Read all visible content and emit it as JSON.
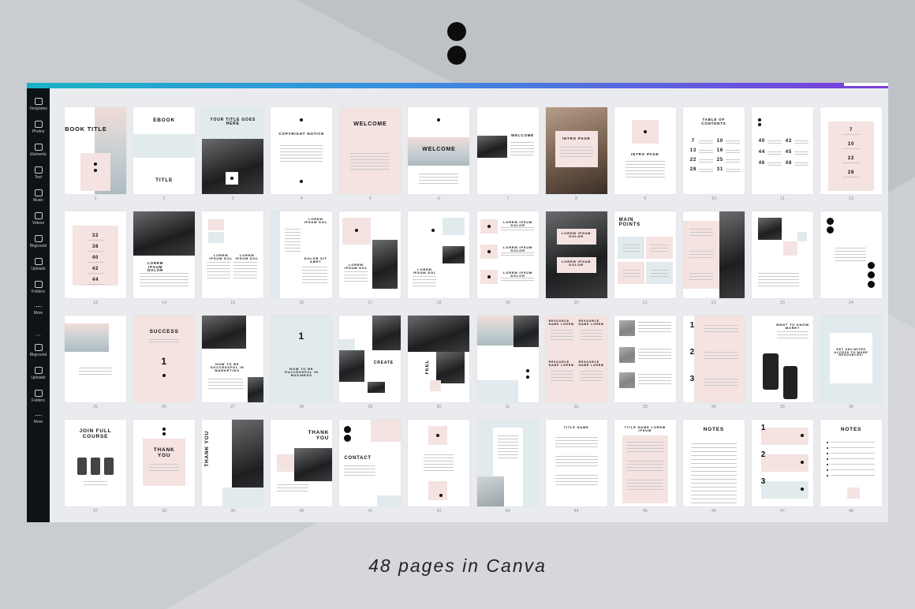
{
  "sidebar": {
    "items": [
      {
        "label": "Templates",
        "icon": "templates-icon"
      },
      {
        "label": "Photos",
        "icon": "photos-icon"
      },
      {
        "label": "Elements",
        "icon": "elements-icon"
      },
      {
        "label": "Text",
        "icon": "text-icon"
      },
      {
        "label": "Music",
        "icon": "music-icon"
      },
      {
        "label": "Videos",
        "icon": "videos-icon"
      },
      {
        "label": "Bkground",
        "icon": "background-icon"
      },
      {
        "label": "Uploads",
        "icon": "uploads-icon"
      },
      {
        "label": "Folders",
        "icon": "folders-icon"
      },
      {
        "label": "More",
        "icon": "more-icon"
      }
    ],
    "items2": [
      {
        "label": "Bkground",
        "icon": "background-icon"
      },
      {
        "label": "Uploads",
        "icon": "uploads-icon"
      },
      {
        "label": "Folders",
        "icon": "folders-icon"
      },
      {
        "label": "More",
        "icon": "more-icon"
      }
    ]
  },
  "pages": {
    "p1": {
      "title": "EBOOK TITLE"
    },
    "p2": {
      "title": "EBOOK",
      "bottom": "TITLE"
    },
    "p3": {
      "title": "YOUR TITLE GOES HERE"
    },
    "p4": {
      "title": "COPYRIGHT NOTICE"
    },
    "p5": {
      "title": "WELCOME"
    },
    "p6": {
      "title": "WELCOME"
    },
    "p7": {
      "title": "WELCOME"
    },
    "p8": {
      "title": "INTRO PAGE"
    },
    "p9": {
      "title": "INTRO PAGE"
    },
    "p10": {
      "title": "TABLE OF CONTENTS",
      "nums": [
        "7",
        "10",
        "13",
        "16",
        "22",
        "25",
        "28",
        "31"
      ]
    },
    "p11": {
      "nums": [
        "40",
        "42",
        "44",
        "45",
        "46",
        "48"
      ]
    },
    "p12": {
      "nums": [
        "7",
        "10",
        "22",
        "28"
      ]
    },
    "p13": {
      "nums": [
        "32",
        "38",
        "40",
        "42",
        "44"
      ]
    },
    "p14": {
      "title": "LOREM IPSUM DOLOR"
    },
    "p15": {
      "title": "LOREM IPSUM DOL",
      "sub": "LOREM IPSUM DOL"
    },
    "p16": {
      "title": "LOREM IPSUM DOL",
      "sub": "DOLOR SIT AMET"
    },
    "p17": {
      "title": "LOREM IPSUM DOL"
    },
    "p18": {
      "title": "LOREM IPSUM DOL"
    },
    "p19": {
      "title": "LOREM IPSUM DOLOR"
    },
    "p20": {
      "title": "LOREM IPSUM DOLOR",
      "sub": "LOREM IPSUM DOLOR"
    },
    "p21": {
      "title": "MAIN POINTS"
    },
    "p26": {
      "title": "SUCCESS",
      "num": "1"
    },
    "p27": {
      "title": "HOW TO BE SUCCESSFUL IN MARKETING"
    },
    "p28": {
      "num": "1",
      "title": "HOW TO BE SUCCESSFUL IN BUSINESS"
    },
    "p29": {
      "title": "CREATE"
    },
    "p30": {
      "title": "FEEL"
    },
    "p32": {
      "title": "RESOURCE NAME LOREM"
    },
    "p34": {
      "nums": [
        "1",
        "2",
        "3"
      ]
    },
    "p35": {
      "title": "WANT TO KNOW MORE?"
    },
    "p36": {
      "title": "GET UNLIMITED ACCESS TO MORE RESOURCES!"
    },
    "p37": {
      "title": "JOIN FULL COURSE"
    },
    "p38": {
      "title": "THANK YOU"
    },
    "p39": {
      "title": "THANK YOU"
    },
    "p40": {
      "title": "THANK YOU"
    },
    "p41": {
      "title": "CONTACT"
    },
    "p44": {
      "title": "TITLE NAME"
    },
    "p45": {
      "title": "TITLE NAME LOREM IPSUM"
    },
    "p46": {
      "title": "NOTES"
    },
    "p47": {
      "nums": [
        "1",
        "2",
        "3"
      ]
    },
    "p48": {
      "title": "NOTES"
    }
  },
  "page_numbers": [
    "1",
    "2",
    "3",
    "4",
    "5",
    "6",
    "7",
    "8",
    "9",
    "10",
    "11",
    "12",
    "13",
    "14",
    "15",
    "16",
    "17",
    "18",
    "19",
    "20",
    "21",
    "22",
    "23",
    "24",
    "25",
    "26",
    "27",
    "28",
    "29",
    "30",
    "31",
    "32",
    "33",
    "34",
    "35",
    "36",
    "37",
    "38",
    "39",
    "40",
    "41",
    "42",
    "43",
    "44",
    "45",
    "46",
    "47",
    "48"
  ],
  "caption": "48 pages in Canva"
}
